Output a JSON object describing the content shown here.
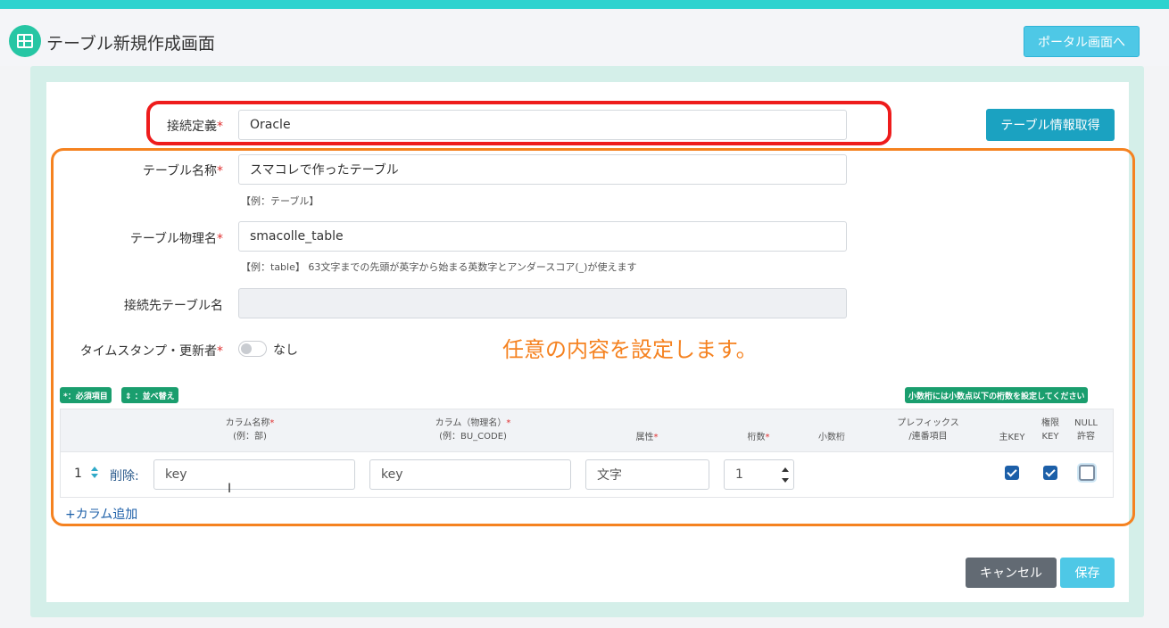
{
  "header": {
    "title": "テーブル新規作成画面",
    "portal_button": "ポータル画面へ",
    "icon": "table-grid-icon"
  },
  "form": {
    "connection": {
      "label": "接続定義",
      "required": "*",
      "value": "Oracle"
    },
    "fetch_button": "テーブル情報取得",
    "table_name": {
      "label": "テーブル名称",
      "required": "*",
      "value": "スマコレで作ったテーブル",
      "hint": "【例：テーブル】"
    },
    "physical_name": {
      "label": "テーブル物理名",
      "required": "*",
      "value": "smacolle_table",
      "hint": "【例：table】 63文字までの先頭が英字から始まる英数字とアンダースコア(_)が使えます"
    },
    "target_table": {
      "label": "接続先テーブル名",
      "value": ""
    },
    "timestamp": {
      "label": "タイムスタンプ・更新者",
      "required": "*",
      "toggle_label": "なし"
    }
  },
  "annotation": "任意の内容を設定します。",
  "badges": {
    "required": "*：必須項目",
    "sort": "⇕ ：並べ替え",
    "decimal_note": "小数桁には小数点以下の桁数を設定してください"
  },
  "columns_table": {
    "headers": {
      "column_name": "カラム名称",
      "column_name_example": "(例：部)",
      "physical": "カラム（物理名）",
      "physical_example": "(例：BU_CODE)",
      "attribute": "属性",
      "digits": "桁数",
      "decimal": "小数桁",
      "prefix_1": "プレフィックス",
      "prefix_2": "/連番項目",
      "primary_key": "主KEY",
      "auth_1": "権限",
      "auth_2": "KEY",
      "null_1": "NULL",
      "null_2": "許容",
      "required_mark": "*"
    },
    "rows": [
      {
        "index": "1",
        "delete_label": "削除:",
        "column_name": "key",
        "physical_name": "key",
        "attribute": "文字",
        "digits": "1",
        "primary_key": true,
        "auth_key": true,
        "null_allowed": false
      }
    ],
    "add_column": "+カラム追加"
  },
  "footer": {
    "cancel": "キャンセル",
    "save": "保存"
  },
  "colors": {
    "accent": "#2ed3cf",
    "highlight_red": "#ee1c1c",
    "highlight_orange": "#f58220",
    "primary_button": "#1ba2c1",
    "badge_green": "#1a9e6e"
  }
}
